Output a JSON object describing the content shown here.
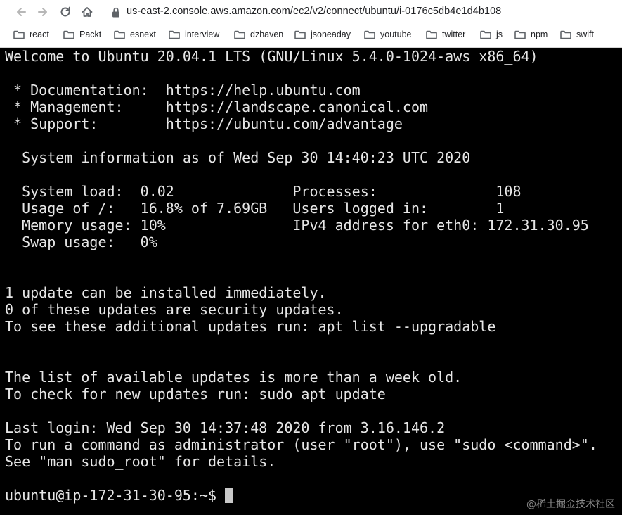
{
  "browser": {
    "url": "us-east-2.console.aws.amazon.com/ec2/v2/connect/ubuntu/i-0176c5db4e1d4b108",
    "nav_icons": [
      "back-icon",
      "forward-icon",
      "reload-icon",
      "home-icon",
      "lock-icon"
    ],
    "bookmarks": [
      {
        "label": "react",
        "icon": "folder-icon"
      },
      {
        "label": "Packt",
        "icon": "folder-icon"
      },
      {
        "label": "esnext",
        "icon": "folder-icon"
      },
      {
        "label": "interview",
        "icon": "folder-icon"
      },
      {
        "label": "dzhaven",
        "icon": "folder-icon"
      },
      {
        "label": "jsoneaday",
        "icon": "folder-icon"
      },
      {
        "label": "youtube",
        "icon": "folder-icon"
      },
      {
        "label": "twitter",
        "icon": "folder-icon"
      },
      {
        "label": "js",
        "icon": "folder-icon"
      },
      {
        "label": "npm",
        "icon": "folder-icon"
      },
      {
        "label": "swift",
        "icon": "folder-icon"
      }
    ]
  },
  "terminal": {
    "lines": [
      "Welcome to Ubuntu 20.04.1 LTS (GNU/Linux 5.4.0-1024-aws x86_64)",
      "",
      " * Documentation:  https://help.ubuntu.com",
      " * Management:     https://landscape.canonical.com",
      " * Support:        https://ubuntu.com/advantage",
      "",
      "  System information as of Wed Sep 30 14:40:23 UTC 2020",
      "",
      "  System load:  0.02              Processes:              108",
      "  Usage of /:   16.8% of 7.69GB   Users logged in:        1",
      "  Memory usage: 10%               IPv4 address for eth0: 172.31.30.95",
      "  Swap usage:   0%",
      "",
      "",
      "1 update can be installed immediately.",
      "0 of these updates are security updates.",
      "To see these additional updates run: apt list --upgradable",
      "",
      "",
      "The list of available updates is more than a week old.",
      "To check for new updates run: sudo apt update",
      "",
      "Last login: Wed Sep 30 14:37:48 2020 from 3.16.146.2",
      "To run a command as administrator (user \"root\"), use \"sudo <command>\".",
      "See \"man sudo_root\" for details.",
      ""
    ],
    "prompt": "ubuntu@ip-172-31-30-95:~$ ",
    "colors": {
      "background": "#000000",
      "text": "#e6e6e6",
      "cursor": "#c8c8c8"
    }
  },
  "watermark": "@稀土掘金技术社区"
}
